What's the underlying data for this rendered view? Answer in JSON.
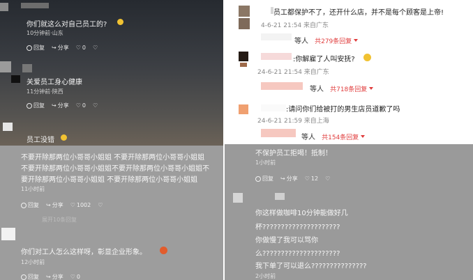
{
  "p1": {
    "c1": {
      "text": "你们就这么对自己员工的?",
      "meta": "10分钟前·山东",
      "reply": "回复",
      "share": "分享",
      "likes": "0"
    },
    "c2": {
      "text": "关爱员工身心健康",
      "meta": "11分钟前·陕西",
      "reply": "回复",
      "share": "分享",
      "likes": "0"
    },
    "c3": {
      "text": "员工没错"
    }
  },
  "p2": {
    "c1": {
      "text": "员工都保护不了，还开什么店，并不是每个顾客是上帝!",
      "meta": "4-6-21 21:54 来自广东",
      "more_prefix": "等人",
      "more_link": "共279条回复"
    },
    "c2": {
      "text": ":你解雇了人叫安抚?",
      "meta": "24-6-21 21:54 来自广东",
      "more_prefix": "等人",
      "more_link": "共718条回复"
    },
    "c3": {
      "text": ":请问你们给被打的男生店员道歉了吗",
      "meta": "24-6-21 21:59 来自上海",
      "more_prefix": "等人",
      "more_link": "共154条回复"
    }
  },
  "p3": {
    "c1": {
      "lines": [
        "不要开除那两位小哥哥小姐姐 不要开除那两位小哥哥小姐姐",
        "不要开除那两位小哥哥小姐姐不要开除那两位小哥哥小姐姐不",
        "要开除那两位小哥哥小姐姐 不要开除那两位小哥哥小姐姐"
      ],
      "meta": "11小时前",
      "reply": "回复",
      "share": "分享",
      "likes": "1002",
      "more": "展开10条回复"
    },
    "c2": {
      "text": "你们对工人怎么这样呀，彰显企业形象。",
      "meta": "12小时前",
      "reply": "回复",
      "share": "分享",
      "likes": "0"
    }
  },
  "p4": {
    "c1": {
      "text": "不保护员工拒喝！抵制！",
      "meta": "1小时前",
      "reply": "回复",
      "share": "分享",
      "likes": "12"
    },
    "c2": {
      "lines": [
        "你这样做咖啡10分钟能做好几",
        "杯?????????????????????",
        "你做慢了我可以骂你",
        "么?????????????????????",
        "我下单了可以退么???????????????"
      ],
      "meta": "2小时前"
    }
  }
}
